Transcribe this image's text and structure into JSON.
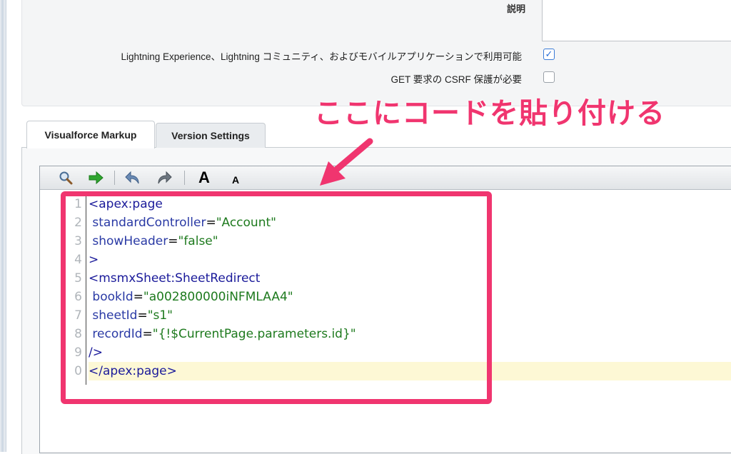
{
  "properties": {
    "description_label": "説明",
    "lightning_label": "Lightning Experience、Lightning コミュニティ、およびモバイルアプリケーションで利用可能",
    "lightning_checked": true,
    "csrf_label": "GET 要求の CSRF 保護が必要",
    "csrf_checked": false
  },
  "tabs": [
    {
      "label": "Visualforce Markup",
      "active": true
    },
    {
      "label": "Version Settings",
      "active": false
    }
  ],
  "toolbar": {
    "icons": [
      "search-icon",
      "go-arrow-icon",
      "undo-icon",
      "redo-icon",
      "font-larger-icon",
      "font-smaller-icon"
    ],
    "font_larger": "A",
    "font_smaller": "A"
  },
  "editor": {
    "line_numbers": [
      "1",
      "2",
      "3",
      "4",
      "5",
      "6",
      "7",
      "8",
      "9",
      "0"
    ],
    "lines": [
      {
        "parts": [
          {
            "t": "tag",
            "v": "<apex:page"
          }
        ]
      },
      {
        "parts": [
          {
            "t": "attr",
            "v": " standardController"
          },
          {
            "t": "plain",
            "v": "="
          },
          {
            "t": "val",
            "v": "\"Account\""
          }
        ]
      },
      {
        "parts": [
          {
            "t": "attr",
            "v": " showHeader"
          },
          {
            "t": "plain",
            "v": "="
          },
          {
            "t": "val",
            "v": "\"false\""
          }
        ]
      },
      {
        "parts": [
          {
            "t": "tag",
            "v": ">"
          }
        ]
      },
      {
        "parts": [
          {
            "t": "tag",
            "v": "<msmxSheet:SheetRedirect"
          }
        ]
      },
      {
        "parts": [
          {
            "t": "attr",
            "v": " bookId"
          },
          {
            "t": "plain",
            "v": "="
          },
          {
            "t": "val",
            "v": "\"a002800000iNFMLAA4\""
          }
        ]
      },
      {
        "parts": [
          {
            "t": "attr",
            "v": " sheetId"
          },
          {
            "t": "plain",
            "v": "="
          },
          {
            "t": "val",
            "v": "\"s1\""
          }
        ]
      },
      {
        "parts": [
          {
            "t": "attr",
            "v": " recordId"
          },
          {
            "t": "plain",
            "v": "="
          },
          {
            "t": "val",
            "v": "\"{!$CurrentPage.parameters.id}\""
          }
        ]
      },
      {
        "parts": [
          {
            "t": "tag",
            "v": "/>"
          }
        ]
      },
      {
        "parts": [
          {
            "t": "tag",
            "v": "</apex:page>"
          }
        ],
        "highlight": true
      }
    ]
  },
  "annotation": {
    "text": "ここにコードを貼り付ける",
    "color": "#f0356f"
  }
}
